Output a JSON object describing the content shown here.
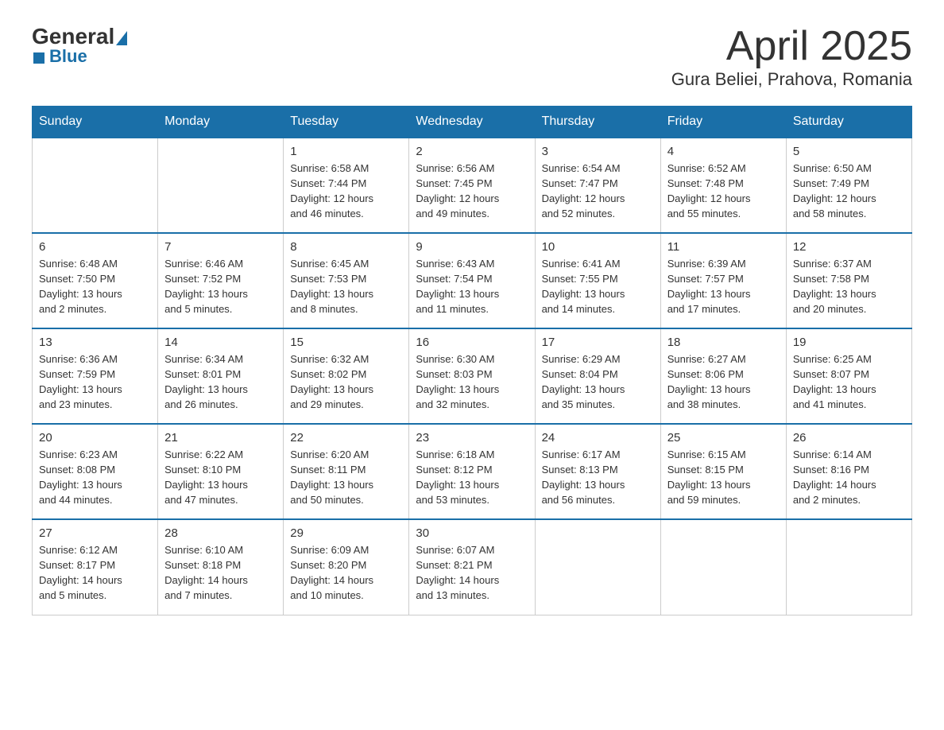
{
  "logo": {
    "text_general": "General",
    "text_blue": "Blue"
  },
  "title": "April 2025",
  "subtitle": "Gura Beliei, Prahova, Romania",
  "days_of_week": [
    "Sunday",
    "Monday",
    "Tuesday",
    "Wednesday",
    "Thursday",
    "Friday",
    "Saturday"
  ],
  "weeks": [
    [
      {
        "day": "",
        "info": ""
      },
      {
        "day": "",
        "info": ""
      },
      {
        "day": "1",
        "info": "Sunrise: 6:58 AM\nSunset: 7:44 PM\nDaylight: 12 hours\nand 46 minutes."
      },
      {
        "day": "2",
        "info": "Sunrise: 6:56 AM\nSunset: 7:45 PM\nDaylight: 12 hours\nand 49 minutes."
      },
      {
        "day": "3",
        "info": "Sunrise: 6:54 AM\nSunset: 7:47 PM\nDaylight: 12 hours\nand 52 minutes."
      },
      {
        "day": "4",
        "info": "Sunrise: 6:52 AM\nSunset: 7:48 PM\nDaylight: 12 hours\nand 55 minutes."
      },
      {
        "day": "5",
        "info": "Sunrise: 6:50 AM\nSunset: 7:49 PM\nDaylight: 12 hours\nand 58 minutes."
      }
    ],
    [
      {
        "day": "6",
        "info": "Sunrise: 6:48 AM\nSunset: 7:50 PM\nDaylight: 13 hours\nand 2 minutes."
      },
      {
        "day": "7",
        "info": "Sunrise: 6:46 AM\nSunset: 7:52 PM\nDaylight: 13 hours\nand 5 minutes."
      },
      {
        "day": "8",
        "info": "Sunrise: 6:45 AM\nSunset: 7:53 PM\nDaylight: 13 hours\nand 8 minutes."
      },
      {
        "day": "9",
        "info": "Sunrise: 6:43 AM\nSunset: 7:54 PM\nDaylight: 13 hours\nand 11 minutes."
      },
      {
        "day": "10",
        "info": "Sunrise: 6:41 AM\nSunset: 7:55 PM\nDaylight: 13 hours\nand 14 minutes."
      },
      {
        "day": "11",
        "info": "Sunrise: 6:39 AM\nSunset: 7:57 PM\nDaylight: 13 hours\nand 17 minutes."
      },
      {
        "day": "12",
        "info": "Sunrise: 6:37 AM\nSunset: 7:58 PM\nDaylight: 13 hours\nand 20 minutes."
      }
    ],
    [
      {
        "day": "13",
        "info": "Sunrise: 6:36 AM\nSunset: 7:59 PM\nDaylight: 13 hours\nand 23 minutes."
      },
      {
        "day": "14",
        "info": "Sunrise: 6:34 AM\nSunset: 8:01 PM\nDaylight: 13 hours\nand 26 minutes."
      },
      {
        "day": "15",
        "info": "Sunrise: 6:32 AM\nSunset: 8:02 PM\nDaylight: 13 hours\nand 29 minutes."
      },
      {
        "day": "16",
        "info": "Sunrise: 6:30 AM\nSunset: 8:03 PM\nDaylight: 13 hours\nand 32 minutes."
      },
      {
        "day": "17",
        "info": "Sunrise: 6:29 AM\nSunset: 8:04 PM\nDaylight: 13 hours\nand 35 minutes."
      },
      {
        "day": "18",
        "info": "Sunrise: 6:27 AM\nSunset: 8:06 PM\nDaylight: 13 hours\nand 38 minutes."
      },
      {
        "day": "19",
        "info": "Sunrise: 6:25 AM\nSunset: 8:07 PM\nDaylight: 13 hours\nand 41 minutes."
      }
    ],
    [
      {
        "day": "20",
        "info": "Sunrise: 6:23 AM\nSunset: 8:08 PM\nDaylight: 13 hours\nand 44 minutes."
      },
      {
        "day": "21",
        "info": "Sunrise: 6:22 AM\nSunset: 8:10 PM\nDaylight: 13 hours\nand 47 minutes."
      },
      {
        "day": "22",
        "info": "Sunrise: 6:20 AM\nSunset: 8:11 PM\nDaylight: 13 hours\nand 50 minutes."
      },
      {
        "day": "23",
        "info": "Sunrise: 6:18 AM\nSunset: 8:12 PM\nDaylight: 13 hours\nand 53 minutes."
      },
      {
        "day": "24",
        "info": "Sunrise: 6:17 AM\nSunset: 8:13 PM\nDaylight: 13 hours\nand 56 minutes."
      },
      {
        "day": "25",
        "info": "Sunrise: 6:15 AM\nSunset: 8:15 PM\nDaylight: 13 hours\nand 59 minutes."
      },
      {
        "day": "26",
        "info": "Sunrise: 6:14 AM\nSunset: 8:16 PM\nDaylight: 14 hours\nand 2 minutes."
      }
    ],
    [
      {
        "day": "27",
        "info": "Sunrise: 6:12 AM\nSunset: 8:17 PM\nDaylight: 14 hours\nand 5 minutes."
      },
      {
        "day": "28",
        "info": "Sunrise: 6:10 AM\nSunset: 8:18 PM\nDaylight: 14 hours\nand 7 minutes."
      },
      {
        "day": "29",
        "info": "Sunrise: 6:09 AM\nSunset: 8:20 PM\nDaylight: 14 hours\nand 10 minutes."
      },
      {
        "day": "30",
        "info": "Sunrise: 6:07 AM\nSunset: 8:21 PM\nDaylight: 14 hours\nand 13 minutes."
      },
      {
        "day": "",
        "info": ""
      },
      {
        "day": "",
        "info": ""
      },
      {
        "day": "",
        "info": ""
      }
    ]
  ]
}
